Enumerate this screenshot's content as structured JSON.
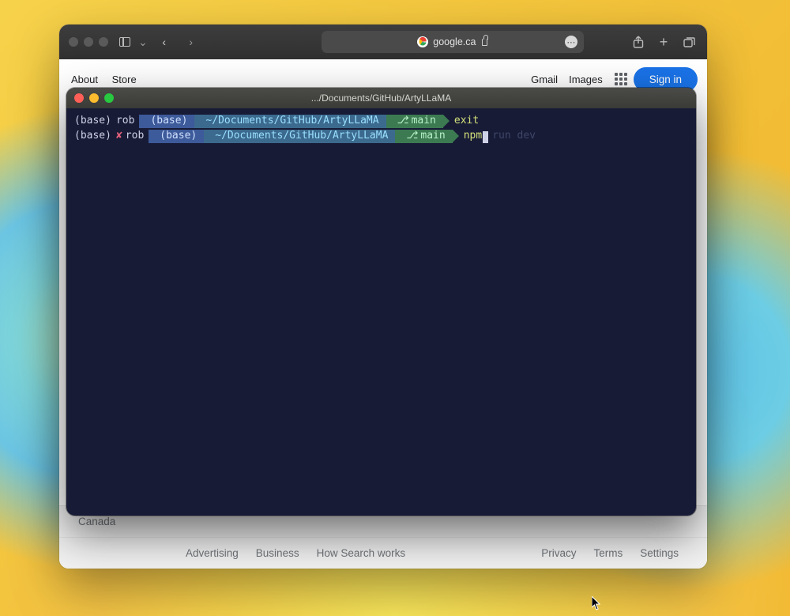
{
  "browser": {
    "address": "google.ca",
    "toolbar_icons": {
      "sidebar": "sidebar",
      "back": "‹",
      "forward": "›",
      "share": "share",
      "new_tab": "+",
      "tabs": "tabs"
    }
  },
  "google": {
    "header": {
      "about": "About",
      "store": "Store",
      "gmail": "Gmail",
      "images": "Images",
      "signin": "Sign in"
    },
    "footer": {
      "country": "Canada",
      "advertising": "Advertising",
      "business": "Business",
      "how": "How Search works",
      "privacy": "Privacy",
      "terms": "Terms",
      "settings": "Settings"
    }
  },
  "terminal": {
    "title": ".../Documents/GitHub/ArtyLLaMA",
    "lines": [
      {
        "env": "(base)",
        "user": "rob",
        "env2": "(base)",
        "path": "~/Documents/GitHub/ArtyLLaMA",
        "branch_icon": "⎇",
        "branch": "main",
        "command": "exit",
        "status": ""
      },
      {
        "env": "(base)",
        "status": "✘",
        "user": "rob",
        "env2": "(base)",
        "path": "~/Documents/GitHub/ArtyLLaMA",
        "branch_icon": "⎇",
        "branch": "main",
        "typed": "npm",
        "suggestion": "run dev"
      }
    ]
  }
}
